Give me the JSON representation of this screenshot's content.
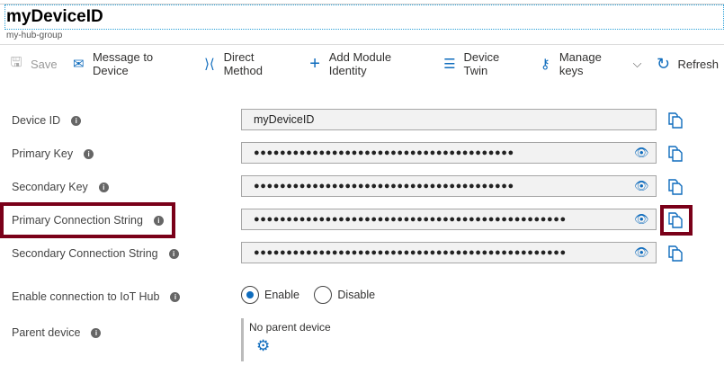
{
  "header": {
    "title": "myDeviceID",
    "subtitle": "my-hub-group"
  },
  "toolbar": [
    {
      "label": "Save",
      "icon": "save-icon",
      "disabled": true
    },
    {
      "label": "Message to Device",
      "icon": "mail-icon"
    },
    {
      "label": "Direct Method",
      "icon": "direct-method-icon"
    },
    {
      "label": "Add Module Identity",
      "icon": "plus-icon"
    },
    {
      "label": "Device Twin",
      "icon": "list-icon"
    },
    {
      "label": "Manage keys",
      "icon": "key-icon",
      "dropdown": true
    },
    {
      "label": "Refresh",
      "icon": "refresh-icon"
    }
  ],
  "fields": [
    {
      "label": "Device ID",
      "value": "myDeviceID",
      "masked": false
    },
    {
      "label": "Primary Key",
      "value": "●●●●●●●●●●●●●●●●●●●●●●●●●●●●●●●●●●●●●●●●",
      "masked": true
    },
    {
      "label": "Secondary Key",
      "value": "●●●●●●●●●●●●●●●●●●●●●●●●●●●●●●●●●●●●●●●●",
      "masked": true
    },
    {
      "label": "Primary Connection String",
      "value": "●●●●●●●●●●●●●●●●●●●●●●●●●●●●●●●●●●●●●●●●●●●●●●●●",
      "masked": true,
      "highlighted": true
    },
    {
      "label": "Secondary Connection String",
      "value": "●●●●●●●●●●●●●●●●●●●●●●●●●●●●●●●●●●●●●●●●●●●●●●●●",
      "masked": true
    }
  ],
  "connection": {
    "label": "Enable connection to IoT Hub",
    "options": [
      "Enable",
      "Disable"
    ],
    "selected": "Enable"
  },
  "parent": {
    "label": "Parent device",
    "value": "No parent device",
    "icon": "gear-icon"
  },
  "colors": {
    "accent": "#0f6cbd",
    "highlight": "#7a0019"
  }
}
